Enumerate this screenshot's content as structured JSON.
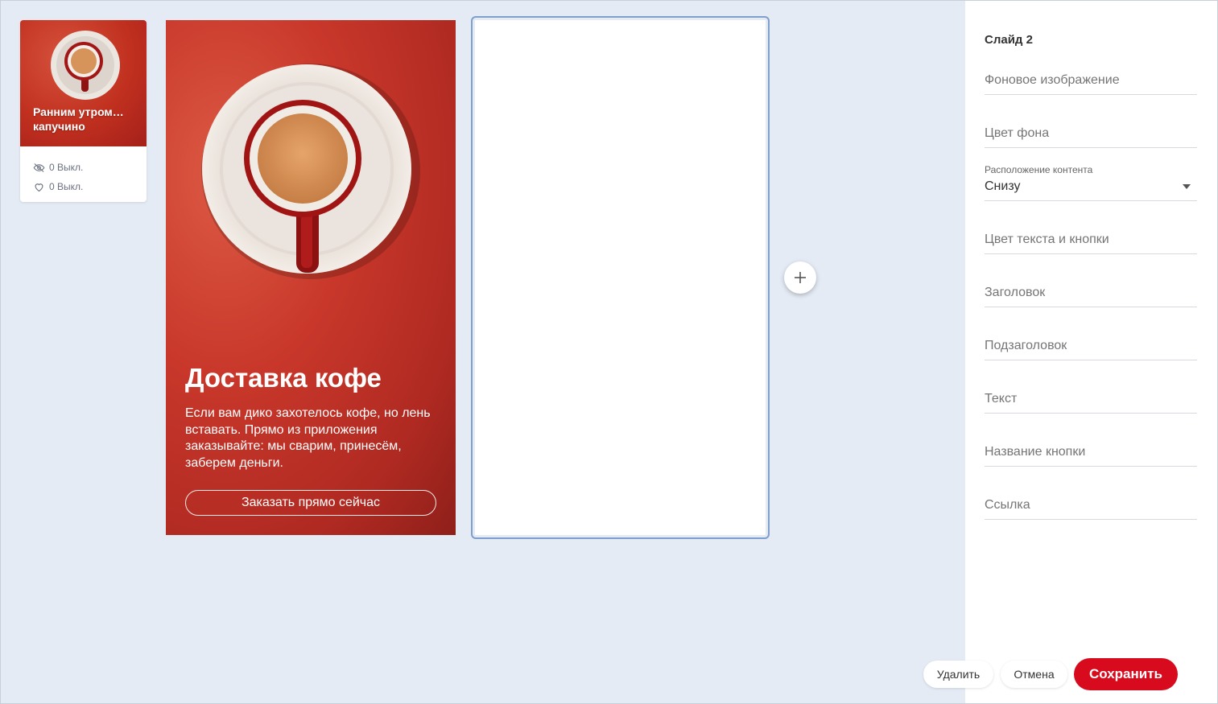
{
  "thumbnail": {
    "title": "Ранним утром… капучино",
    "views": "0 Выкл.",
    "likes": "0 Выкл."
  },
  "slide_one": {
    "heading": "Доставка кофе",
    "body": "Если вам дико захотелось кофе, но лень вставать. Прямо из приложения заказывайте: мы сварим, принесём, заберем деньги.",
    "cta_label": "Заказать прямо сейчас"
  },
  "add_slide": {
    "icon": "plus-icon"
  },
  "panel": {
    "title": "Слайд 2",
    "fields": {
      "background_image": "Фоновое изображение",
      "background_color": "Цвет фона",
      "content_position_label": "Расположение контента",
      "content_position_value": "Снизу",
      "text_button_color": "Цвет текста и кнопки",
      "heading": "Заголовок",
      "subheading": "Подзаголовок",
      "text": "Текст",
      "button_name": "Название кнопки",
      "link": "Ссылка"
    }
  },
  "actions": {
    "delete": "Удалить",
    "cancel": "Отмена",
    "save": "Сохранить"
  },
  "colors": {
    "accent": "#d80b1e",
    "slide_red": "#c8372a",
    "canvas": "#e5ebf5",
    "selection": "#7f9fcc"
  }
}
